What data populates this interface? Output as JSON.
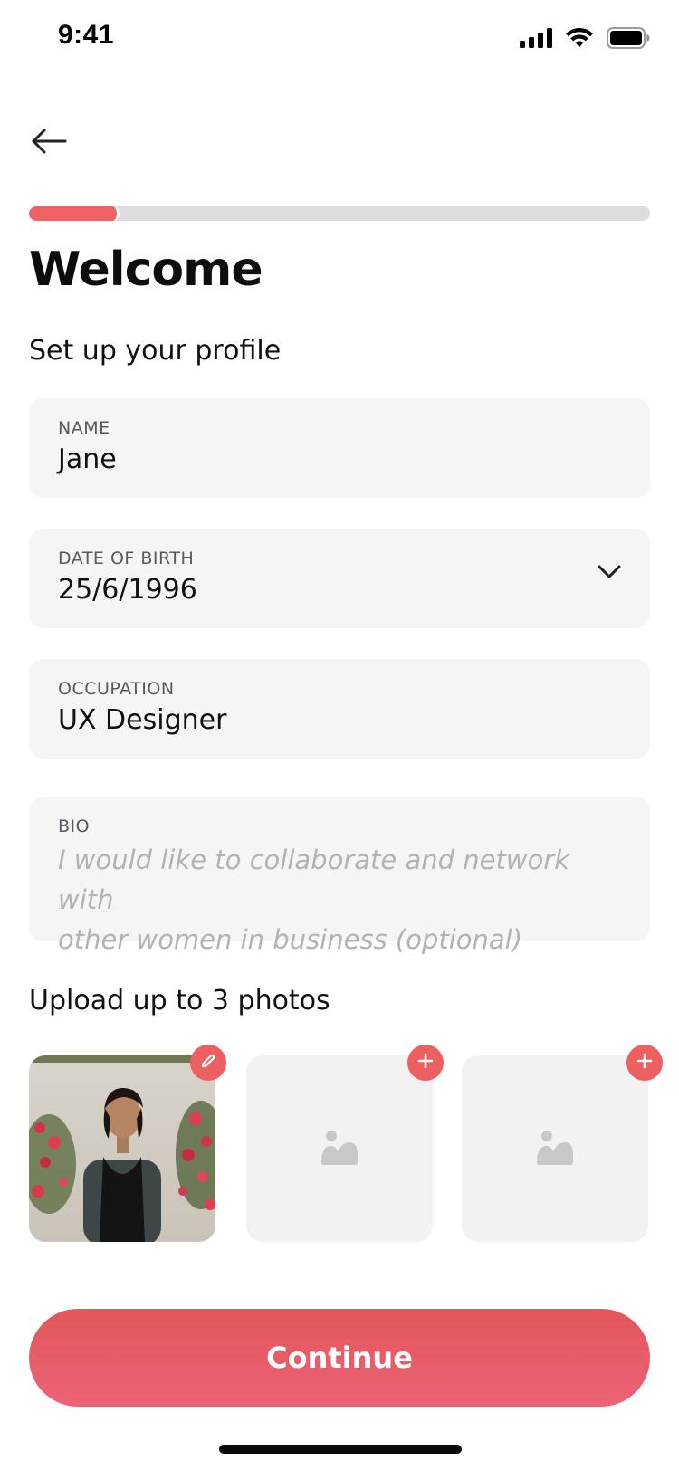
{
  "status_bar": {
    "time": "9:41",
    "icons": [
      "signal-icon",
      "wifi-icon",
      "battery-icon"
    ]
  },
  "nav": {
    "back_icon": "arrow-left-icon"
  },
  "progress": {
    "fraction": 0.146,
    "accent": "#ee6266"
  },
  "header": {
    "title": "Welcome",
    "subtitle": "Set up your profile"
  },
  "form": {
    "name": {
      "label": "NAME",
      "value": "Jane"
    },
    "dob": {
      "label": "DATE OF BIRTH",
      "value": "25/6/1996",
      "icon": "chevron-down-icon"
    },
    "occupation": {
      "label": "OCCUPATION",
      "value": "UX Designer"
    },
    "bio": {
      "label": "BIO",
      "placeholder_line1": "I would like to collaborate and network with",
      "placeholder_line2": "other women in business (optional)"
    }
  },
  "photos": {
    "label": "Upload up to 3 photos",
    "slots": [
      {
        "state": "filled",
        "badge_icon": "pencil-icon"
      },
      {
        "state": "empty",
        "badge_icon": "plus-icon",
        "placeholder_icon": "image-icon"
      },
      {
        "state": "empty",
        "badge_icon": "plus-icon",
        "placeholder_icon": "image-icon"
      }
    ]
  },
  "actions": {
    "continue_label": "Continue"
  },
  "colors": {
    "accent": "#ee5f62",
    "field_bg": "#f5f5f6"
  }
}
